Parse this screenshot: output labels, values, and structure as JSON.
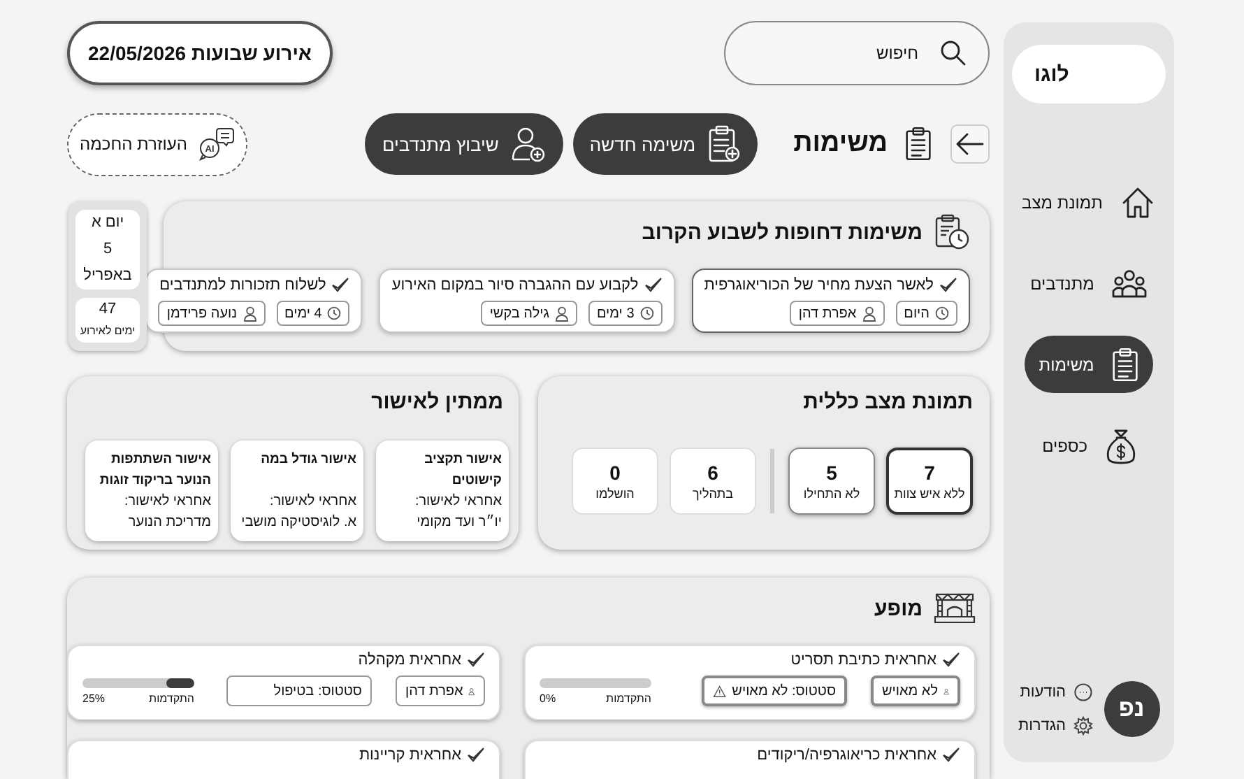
{
  "sidebar": {
    "logo": "לוגו",
    "items": [
      {
        "label": "תמונת מצב",
        "selected": false
      },
      {
        "label": "מתנדבים",
        "selected": false
      },
      {
        "label": "משימות",
        "selected": true
      },
      {
        "label": "כספים",
        "selected": false
      }
    ],
    "notifications": "הודעות",
    "settings": "הגדרות",
    "avatar": "נפ"
  },
  "header": {
    "search": {
      "placeholder": "חיפוש"
    },
    "event": "אירוע שבועות 22/05/2026"
  },
  "toolbar": {
    "title": "משימות",
    "buttons": [
      "משימה חדשה",
      "שיבוץ מתנדבים"
    ],
    "assistant": "העוזרת החכמה",
    "assistant_badge": "AI"
  },
  "date_card": {
    "weekday": "יום א",
    "day": "5",
    "month": "באפריל",
    "countdown": "47",
    "countdown_label": "ימים לאירוע"
  },
  "urgent": {
    "title": "משימות דחופות לשבוע הקרוב",
    "tasks": [
      {
        "title": "לאשר הצעת מחיר של הכוריאוגרפית",
        "due": "היום",
        "person": "אפרת דהן",
        "selected": true
      },
      {
        "title": "לקבוע עם ההגברה סיור במקום האירוע",
        "due": "3 ימים",
        "person": "גילה בקשי",
        "selected": false
      },
      {
        "title": "לשלוח תזכורות למתנדבים",
        "due": "4 ימים",
        "person": "נועה פרידמן",
        "selected": false
      }
    ]
  },
  "status": {
    "title": "תמונת מצב כללית",
    "groups": [
      {
        "kind": "open",
        "stats": [
          {
            "value": "7",
            "label": "ללא איש צוות",
            "selected": true
          },
          {
            "value": "5",
            "label": "לא התחילו",
            "selected": false
          }
        ]
      },
      {
        "kind": "progress",
        "stats": [
          {
            "value": "6",
            "label": "בתהליך",
            "selected": false
          },
          {
            "value": "0",
            "label": "הושלמו",
            "selected": false
          }
        ]
      }
    ]
  },
  "pending": {
    "title": "ממתין לאישור",
    "items": [
      {
        "title": "אישור תקציב קישוטים",
        "responsible_label": "אחראי לאישור:",
        "responsible": "יו״ר ועד מקומי"
      },
      {
        "title": "אישור גודל במה",
        "responsible_label": "אחראי לאישור:",
        "responsible": "א. לוגיסטיקה מושבי"
      },
      {
        "title": "אישור השתתפות הנוער בריקוד זוגות",
        "responsible_label": "אחראי לאישור:",
        "responsible": "מדריכת הנוער"
      }
    ]
  },
  "show": {
    "title": "מופע",
    "roles": [
      {
        "title": "אחראית כתיבת תסריט",
        "person": "לא מאויש",
        "status": "סטטוס: לא מאויש",
        "unassigned": true,
        "progress_label": "התקדמות",
        "percent": "0%",
        "level": 0
      },
      {
        "title": "אחראית מקהלה",
        "person": "אפרת דהן",
        "status": "סטטוס: בטיפול",
        "unassigned": false,
        "progress_label": "התקדמות",
        "percent": "25%",
        "level": 0.25
      },
      {
        "title": "אחראית כריאוגרפיה/ריקודים"
      },
      {
        "title": "אחראית קריינות"
      }
    ]
  }
}
